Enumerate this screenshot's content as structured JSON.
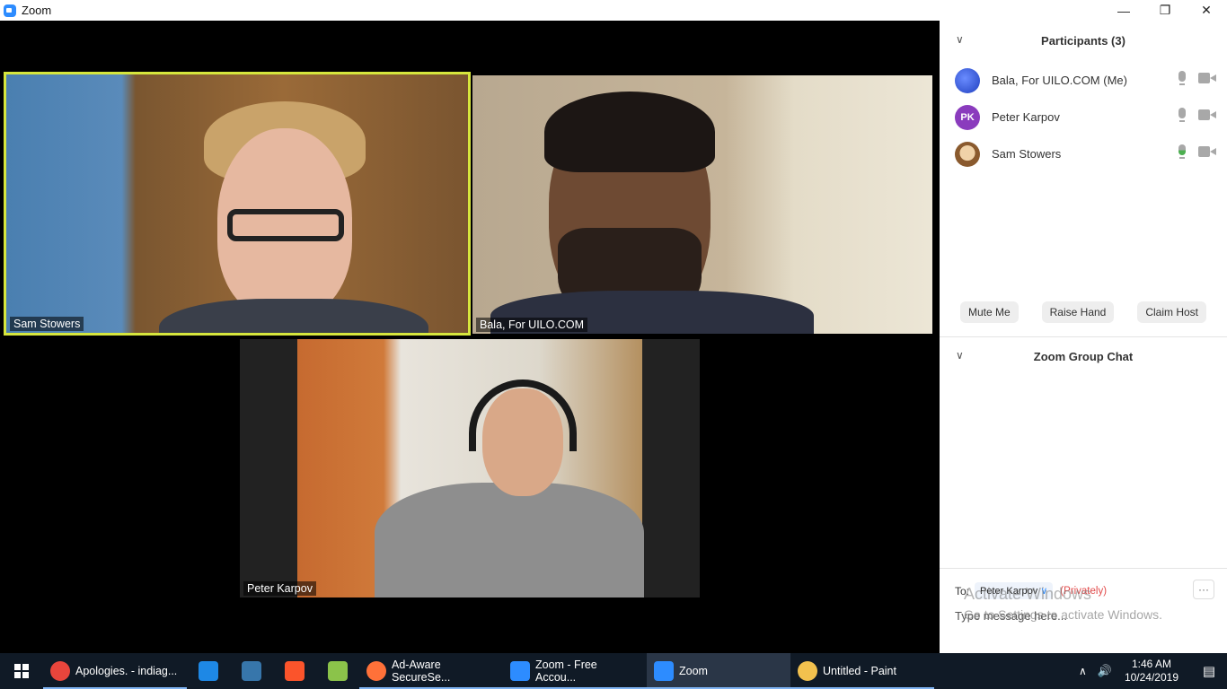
{
  "window": {
    "title": "Zoom",
    "minimize": "—",
    "restore": "❐",
    "close": "✕"
  },
  "videos": [
    {
      "name": "Sam Stowers",
      "active_speaker": true
    },
    {
      "name": "Bala, For UILO.COM"
    },
    {
      "name": "Peter Karpov"
    }
  ],
  "participants": {
    "header": "Participants (3)",
    "items": [
      {
        "name": "Bala, For UILO.COM (Me)",
        "avatar": "blue-figure-avatar",
        "mic": "gray",
        "video": "gray"
      },
      {
        "name": "Peter Karpov",
        "avatar_initials": "PK",
        "avatar_color": "#8a3bbd",
        "mic": "gray",
        "video": "gray"
      },
      {
        "name": "Sam Stowers",
        "avatar": "cartoon-avatar",
        "mic": "green-speaking",
        "video": "gray"
      }
    ],
    "actions": {
      "mute": "Mute Me",
      "raise": "Raise Hand",
      "claim": "Claim Host"
    }
  },
  "chat": {
    "header": "Zoom Group Chat",
    "to_label": "To:",
    "to_value": "Peter Karpov",
    "privately": "(Privately)",
    "more": "···",
    "input_placeholder": "Type message here..."
  },
  "watermark": {
    "line1": "Activate Windows",
    "line2": "Go to Settings to activate Windows."
  },
  "taskbar": {
    "items": [
      {
        "label": "Apologies. - indiag...",
        "icon": "chrome-icon",
        "color": "#e8453c"
      },
      {
        "icon": "network-icon",
        "color": "#1e88e5"
      },
      {
        "icon": "python-icon",
        "color": "#3776ab"
      },
      {
        "icon": "brave-icon",
        "color": "#fb542b"
      },
      {
        "icon": "notepad-icon",
        "color": "#8bc34a"
      },
      {
        "label": "Ad-Aware SecureSe...",
        "icon": "firefox-icon",
        "color": "#ff7139"
      },
      {
        "label": "Zoom - Free Accou...",
        "icon": "zoom-icon",
        "color": "#2d8cff"
      },
      {
        "label": "Zoom",
        "icon": "zoom-icon",
        "color": "#2d8cff"
      },
      {
        "label": "Untitled - Paint",
        "icon": "paint-icon",
        "color": "#f2c14e"
      }
    ],
    "time": "1:46 AM",
    "date": "10/24/2019"
  }
}
